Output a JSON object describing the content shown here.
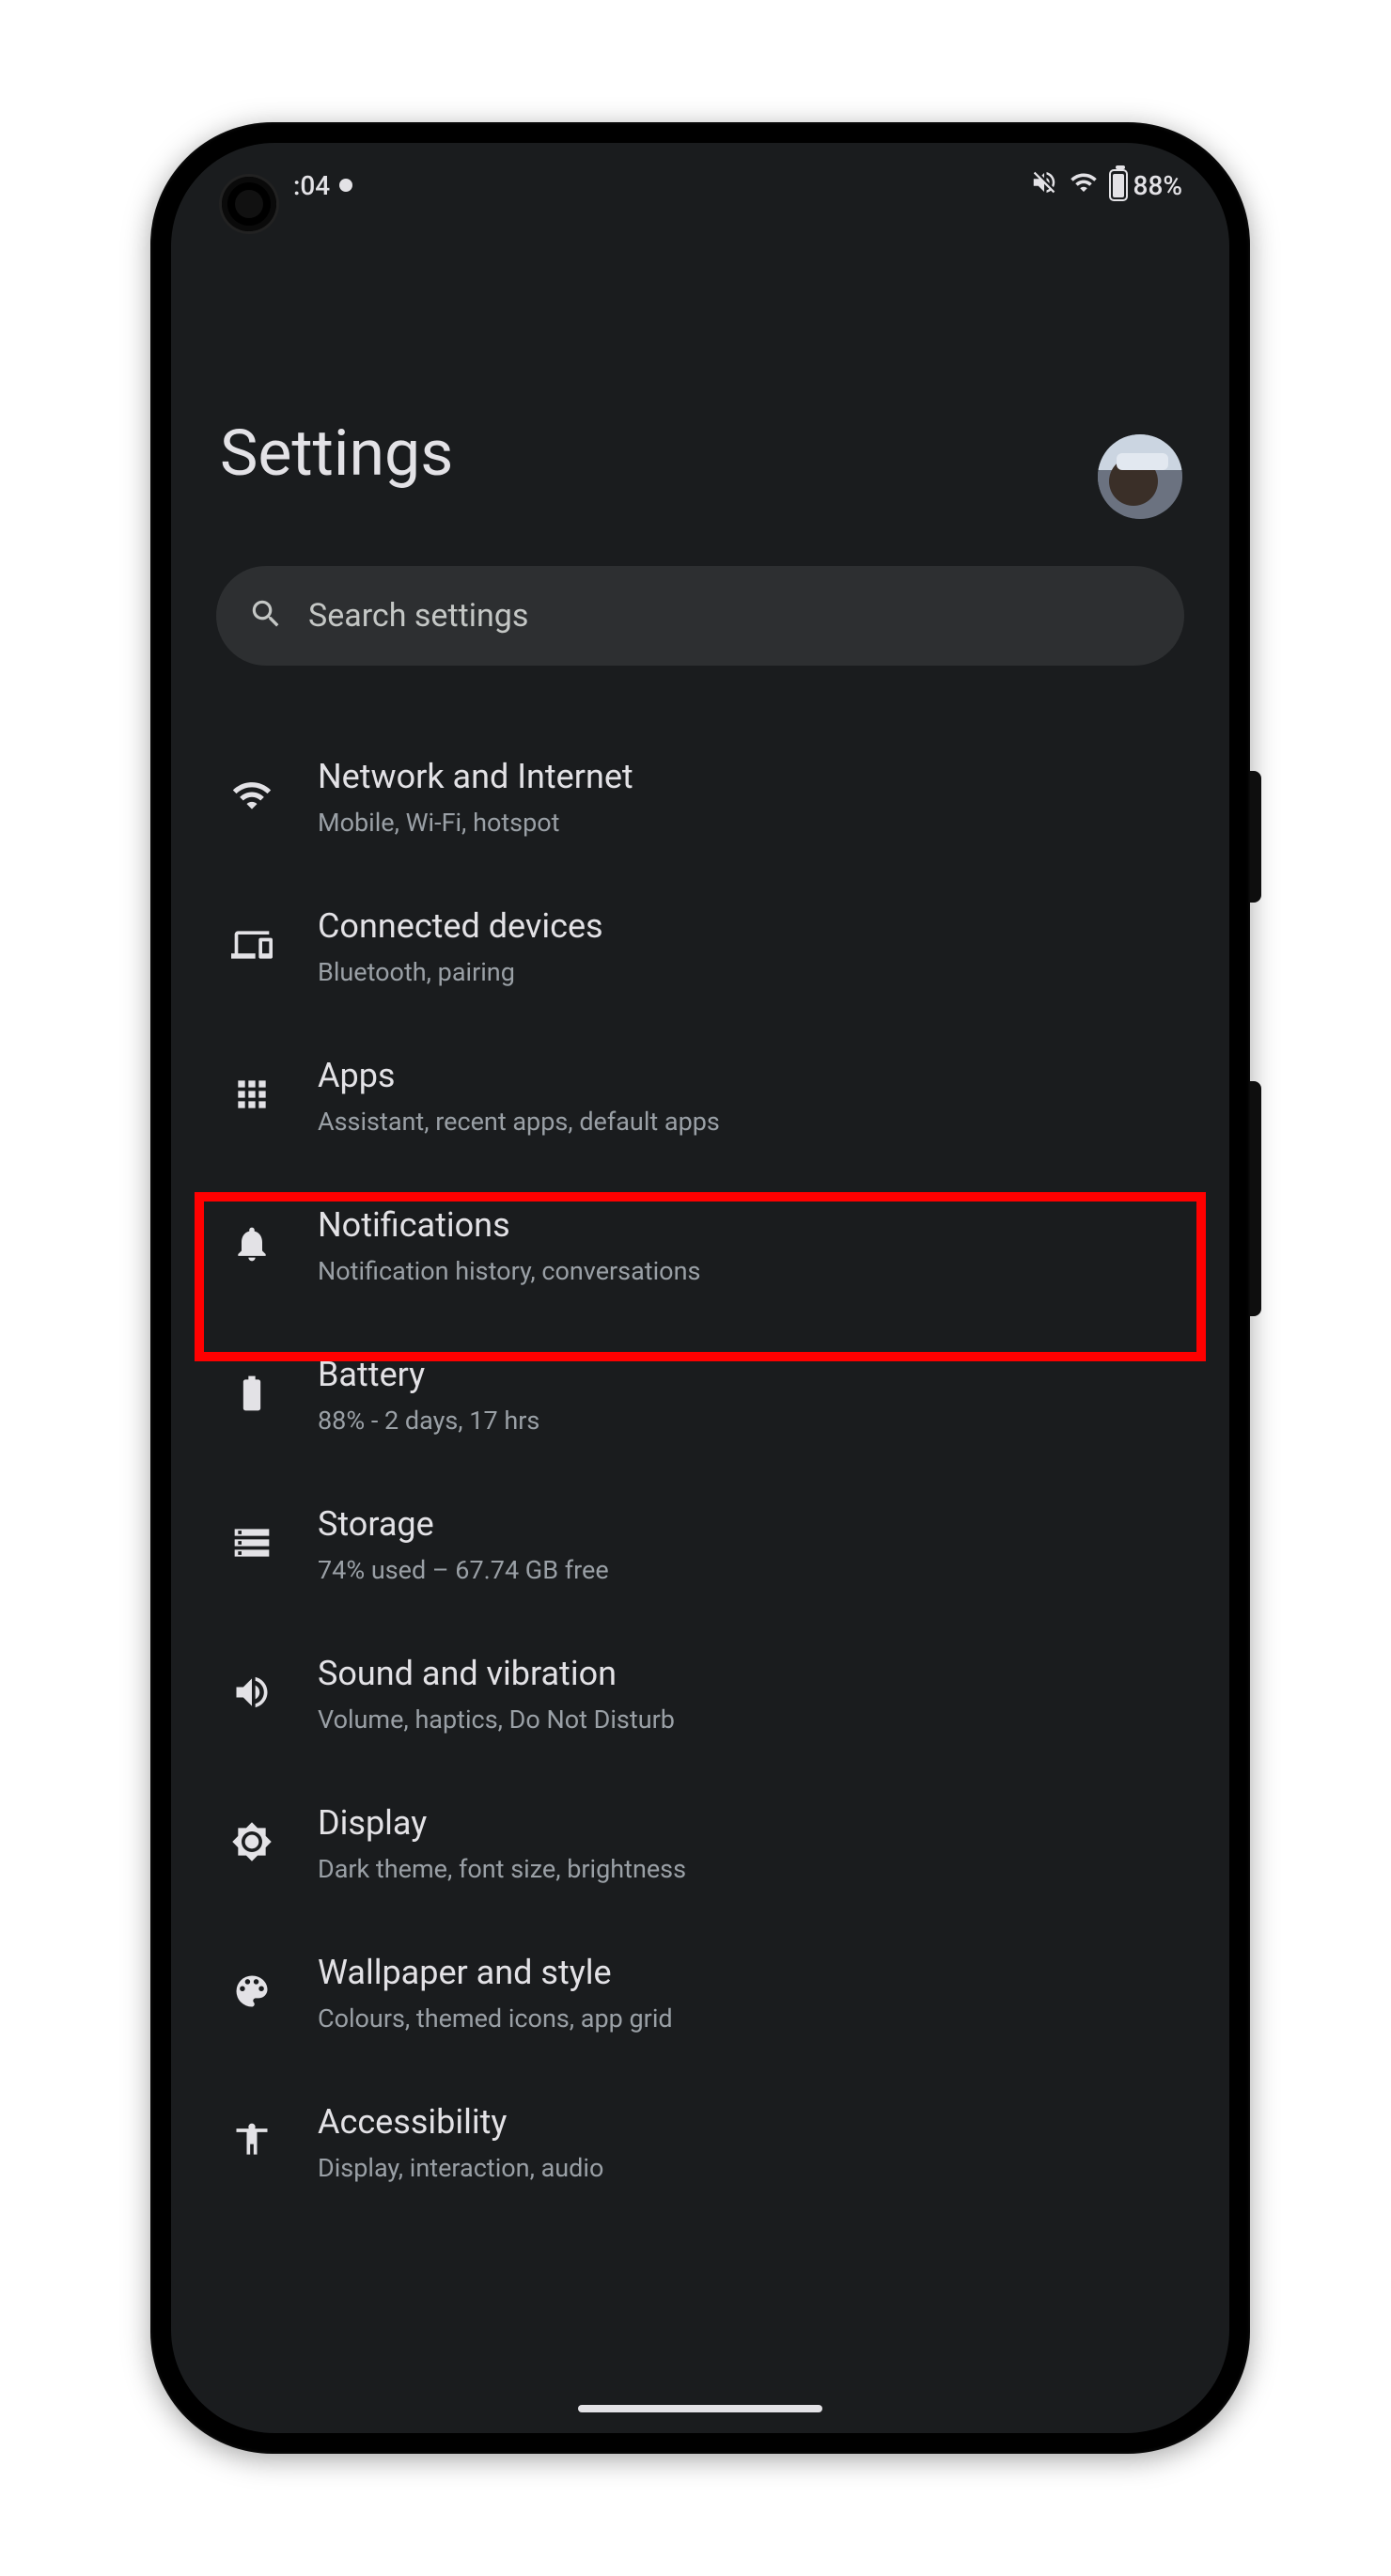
{
  "status": {
    "time": ":04",
    "battery": "88%"
  },
  "header": {
    "title": "Settings"
  },
  "search": {
    "placeholder": "Search settings"
  },
  "items": [
    {
      "title": "Network and Internet",
      "subtitle": "Mobile, Wi-Fi, hotspot"
    },
    {
      "title": "Connected devices",
      "subtitle": "Bluetooth, pairing"
    },
    {
      "title": "Apps",
      "subtitle": "Assistant, recent apps, default apps"
    },
    {
      "title": "Notifications",
      "subtitle": "Notification history, conversations"
    },
    {
      "title": "Battery",
      "subtitle": "88% - 2 days, 17 hrs"
    },
    {
      "title": "Storage",
      "subtitle": "74% used – 67.74 GB free"
    },
    {
      "title": "Sound and vibration",
      "subtitle": "Volume, haptics, Do Not Disturb"
    },
    {
      "title": "Display",
      "subtitle": "Dark theme, font size, brightness"
    },
    {
      "title": "Wallpaper and style",
      "subtitle": "Colours, themed icons, app grid"
    },
    {
      "title": "Accessibility",
      "subtitle": "Display, interaction, audio"
    }
  ],
  "highlightIndex": 2
}
